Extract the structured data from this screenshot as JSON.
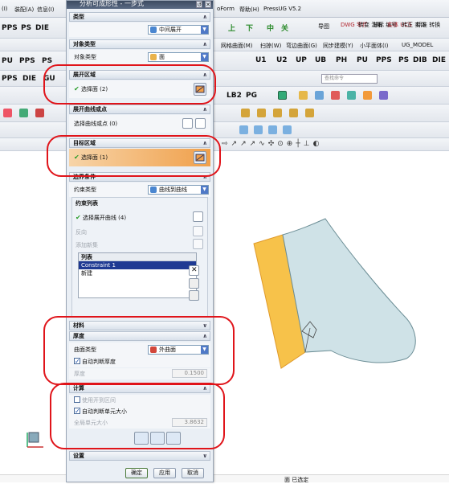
{
  "menubar": {
    "items": [
      "(I)",
      "装配(A)",
      "信息(I)",
      "oForm",
      "帮助(H)",
      "PressUG V5.2"
    ]
  },
  "toolbar_row1": {
    "labels": [
      "上",
      "下",
      "中",
      "关"
    ],
    "small": [
      "导图",
      "DWG 零件",
      "转变 注解",
      "球标 编号",
      "实体 UCS",
      "转正 实体",
      "标准 转换"
    ]
  },
  "toolbar_row2": {
    "prefix": [
      "PPS",
      "PS",
      "DIE"
    ],
    "labels": [
      "U1",
      "U2",
      "UP",
      "UB",
      "PH",
      "PU",
      "PPS",
      "PS",
      "DIB",
      "DIE"
    ],
    "small": [
      "网格曲面(M)",
      "扫掠(W)",
      "弯边曲面(G)",
      "同步建模(Y)",
      "小平面体(I)",
      "UG_MODEL"
    ]
  },
  "toolbar_row3": {
    "labels": [
      "PU",
      "PPS",
      "PS"
    ]
  },
  "toolbar_row4": {
    "labels": [
      "PPS",
      "DIE",
      "GU"
    ],
    "search_placeholder": "查找命令",
    "misc": [
      "LB2",
      "PG"
    ]
  },
  "dialog": {
    "title": "分析可成形性 - 一步式",
    "type_section": "类型",
    "type_value": "中间展开",
    "object_type_section": "对象类型",
    "object_type_label": "对象类型",
    "object_type_value": "面",
    "unfold_region_section": "展开区域",
    "select_face_label": "选择面 (2)",
    "unfold_curve_section": "展开曲线或点",
    "select_curve_label": "选择曲线或点 (0)",
    "target_region_section": "目标区域",
    "target_select_label": "选择面 (1)",
    "boundary_section": "边界条件",
    "constraint_type_label": "约束类型",
    "constraint_type_value": "曲线到曲线",
    "constraint_list_title": "约束列表",
    "select_unfold_curve": "选择展开曲线 (4)",
    "reverse_label": "反向",
    "add_set_label": "添加新集",
    "list_title": "列表",
    "list_rows": [
      "Constraint 1",
      "新建"
    ],
    "material_section": "材料",
    "thickness_section": "厚度",
    "surface_type_label": "曲面类型",
    "surface_type_value": "外曲面",
    "auto_thickness_label": "自动判断厚度",
    "thickness_label": "厚度",
    "thickness_value": "0.1500",
    "compute_section": "计算",
    "use_unfold_direction_label": "使用开到区间",
    "auto_element_size_label": "自动判断单元大小",
    "global_element_label": "全局单元大小",
    "global_element_value": "3.8632",
    "settings_section": "设置",
    "ok": "确定",
    "apply": "应用",
    "cancel": "取消"
  },
  "status": {
    "text": "面 已选定"
  },
  "colors": {
    "accent_red": "#e0141a",
    "title_bar": "#3c4a60",
    "target_fill": "#f0a04b",
    "part_face": "#c8dde3",
    "part_edge": "#f7c24a"
  }
}
